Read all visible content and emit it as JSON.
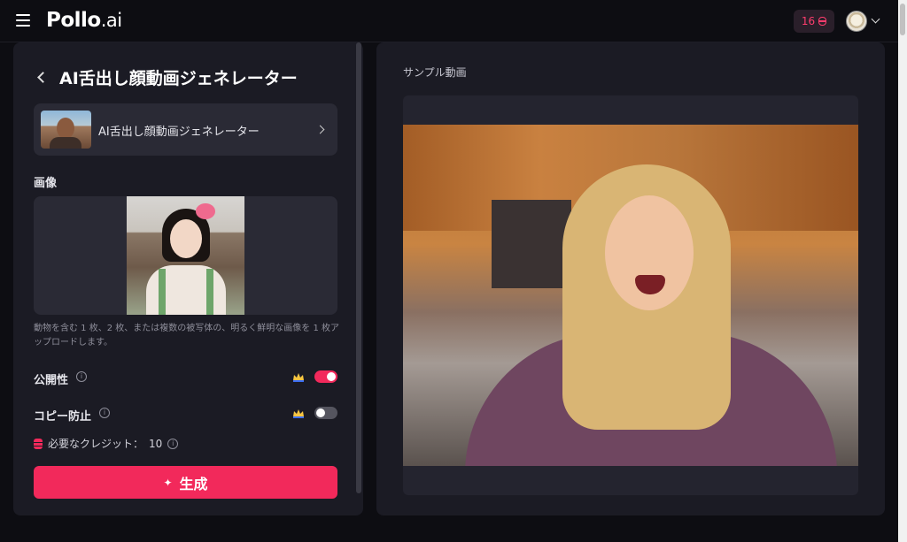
{
  "header": {
    "logo_main": "Pollo",
    "logo_suffix": ".ai",
    "credits": "16"
  },
  "left": {
    "title": "AI舌出し顔動画ジェネレーター",
    "tool_card_label": "AI舌出し顔動画ジェネレーター",
    "image_section_label": "画像",
    "upload_hint": "動物を含む 1 枚、2 枚、または複数の被写体の、明るく鮮明な画像を 1 枚アップロードします。",
    "public_label": "公開性",
    "public_enabled": true,
    "copy_protect_label": "コピー防止",
    "copy_protect_enabled": false,
    "credits_required_label": "必要なクレジット：",
    "credits_required_value": "10",
    "generate_label": "生成"
  },
  "right": {
    "sample_label": "サンプル動画"
  },
  "colors": {
    "accent": "#f2295b",
    "panel": "#1b1b24",
    "background": "#0d0d12"
  }
}
